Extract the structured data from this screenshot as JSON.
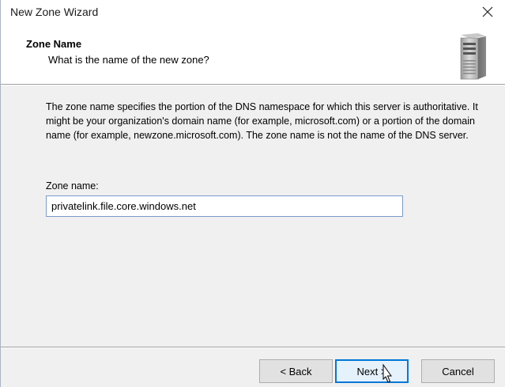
{
  "window": {
    "title": "New Zone Wizard",
    "close_icon": "close-icon"
  },
  "header": {
    "title": "Zone Name",
    "subtitle": "What is the name of the new zone?",
    "icon": "server-icon"
  },
  "body": {
    "description": "The zone name specifies the portion of the DNS namespace for which this server is authoritative. It might be your organization's domain name (for example, microsoft.com) or a portion of the domain name (for example, newzone.microsoft.com). The zone name is not the name of the DNS server.",
    "zone_name_label": "Zone name:",
    "zone_name_value": "privatelink.file.core.windows.net"
  },
  "buttons": {
    "back": "< Back",
    "next": "Next >",
    "cancel": "Cancel"
  },
  "colors": {
    "accent": "#0078d7",
    "dialog_bg": "#f0f0f0"
  }
}
